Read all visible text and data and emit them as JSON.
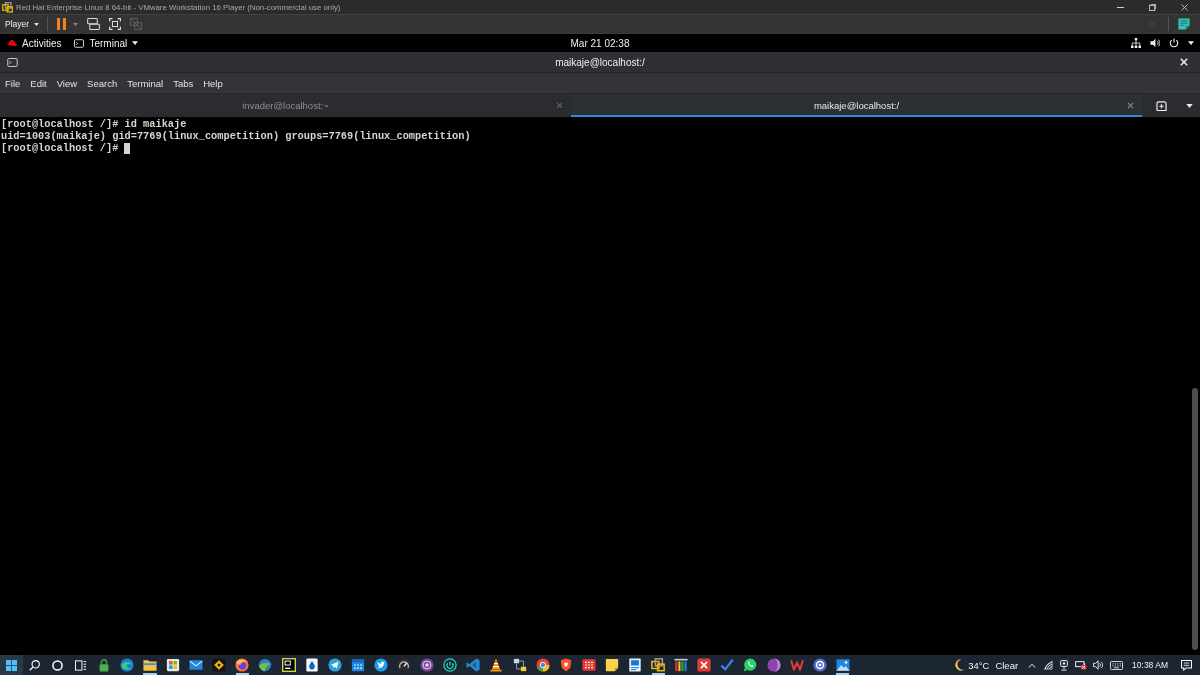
{
  "vm_window": {
    "title": "Red Hat Enterprise Linux 8 64-bit - VMware Workstation 16 Player (Non-commercial use only)",
    "player_menu": "Player",
    "tools": [
      {
        "kind": "pause",
        "disabled": false
      },
      {
        "kind": "keys",
        "disabled": false
      },
      {
        "kind": "fullscreen",
        "disabled": false
      },
      {
        "kind": "unity",
        "disabled": true
      }
    ],
    "side_tools": [
      {
        "kind": "collapse",
        "disabled": true
      },
      {
        "kind": "note",
        "disabled": false
      }
    ]
  },
  "top_bar": {
    "activities": "Activities",
    "app_menu": "Terminal",
    "clock": "Mar 21 02:38"
  },
  "terminal": {
    "title": "maikaje@localhost:/",
    "menu": [
      "File",
      "Edit",
      "View",
      "Search",
      "Terminal",
      "Tabs",
      "Help"
    ],
    "tabs": [
      {
        "label": "invader@localhost:~",
        "selected": false
      },
      {
        "label": "maikaje@localhost:/",
        "selected": true
      }
    ],
    "lines": [
      "[root@localhost /]# id maikaje",
      "uid=1003(maikaje) gid=7769(linux_competition) groups=7769(linux_competition)",
      "[root@localhost /]#"
    ],
    "cursor": true
  },
  "taskbar": {
    "apps": [
      {
        "kind": "padlock",
        "running": false
      },
      {
        "kind": "wave",
        "running": false
      },
      {
        "kind": "folder",
        "running": true
      },
      {
        "kind": "store",
        "running": false
      },
      {
        "kind": "mail",
        "running": false
      },
      {
        "kind": "diamond",
        "running": false
      },
      {
        "kind": "fox",
        "running": true
      },
      {
        "kind": "globe",
        "running": false
      },
      {
        "kind": "ide",
        "running": false
      },
      {
        "kind": "drop",
        "running": false
      },
      {
        "kind": "plane",
        "running": false
      },
      {
        "kind": "calendar",
        "running": false
      },
      {
        "kind": "bird",
        "running": false
      },
      {
        "kind": "gauge",
        "running": false
      },
      {
        "kind": "onion",
        "running": false
      },
      {
        "kind": "power",
        "running": false
      },
      {
        "kind": "code",
        "running": false
      },
      {
        "kind": "cone",
        "running": false
      },
      {
        "kind": "network",
        "running": false
      },
      {
        "kind": "tricolor",
        "running": false
      },
      {
        "kind": "shield",
        "running": false
      },
      {
        "kind": "dots",
        "running": false
      },
      {
        "kind": "sticky",
        "running": false
      },
      {
        "kind": "document",
        "running": false
      },
      {
        "kind": "squares",
        "running": true
      },
      {
        "kind": "bars",
        "running": false
      },
      {
        "kind": "cross",
        "running": false
      },
      {
        "kind": "check",
        "running": false
      },
      {
        "kind": "phone",
        "running": false
      },
      {
        "kind": "orb",
        "running": false
      },
      {
        "kind": "zigzag",
        "running": false
      },
      {
        "kind": "ring",
        "running": false
      },
      {
        "kind": "photo",
        "running": true
      }
    ],
    "weather": {
      "temperature": "34°C",
      "condition": "Clear"
    },
    "time": "10:38 AM"
  }
}
